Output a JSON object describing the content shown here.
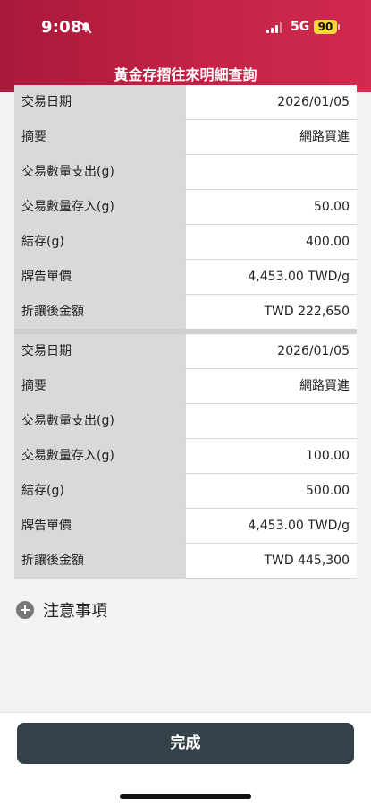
{
  "status_bar": {
    "time": "9:08",
    "network": "5G",
    "battery": "90"
  },
  "header": {
    "title": "黃金存摺往來明細查詢"
  },
  "transactions": [
    {
      "rows": [
        {
          "label": "交易日期",
          "value": "2026/01/05"
        },
        {
          "label": "摘要",
          "value": "網路買進"
        },
        {
          "label": "交易數量支出(g)",
          "value": ""
        },
        {
          "label": "交易數量存入(g)",
          "value": "50.00"
        },
        {
          "label": "結存(g)",
          "value": "400.00"
        },
        {
          "label": "牌告單價",
          "value": "4,453.00 TWD/g"
        },
        {
          "label": "折讓後金額",
          "value": "TWD 222,650"
        }
      ]
    },
    {
      "rows": [
        {
          "label": "交易日期",
          "value": "2026/01/05"
        },
        {
          "label": "摘要",
          "value": "網路買進"
        },
        {
          "label": "交易數量支出(g)",
          "value": ""
        },
        {
          "label": "交易數量存入(g)",
          "value": "100.00"
        },
        {
          "label": "結存(g)",
          "value": "500.00"
        },
        {
          "label": "牌告單價",
          "value": "4,453.00 TWD/g"
        },
        {
          "label": "折讓後金額",
          "value": "TWD 445,300"
        }
      ]
    }
  ],
  "notice": {
    "label": "注意事項"
  },
  "footer": {
    "complete_label": "完成"
  }
}
